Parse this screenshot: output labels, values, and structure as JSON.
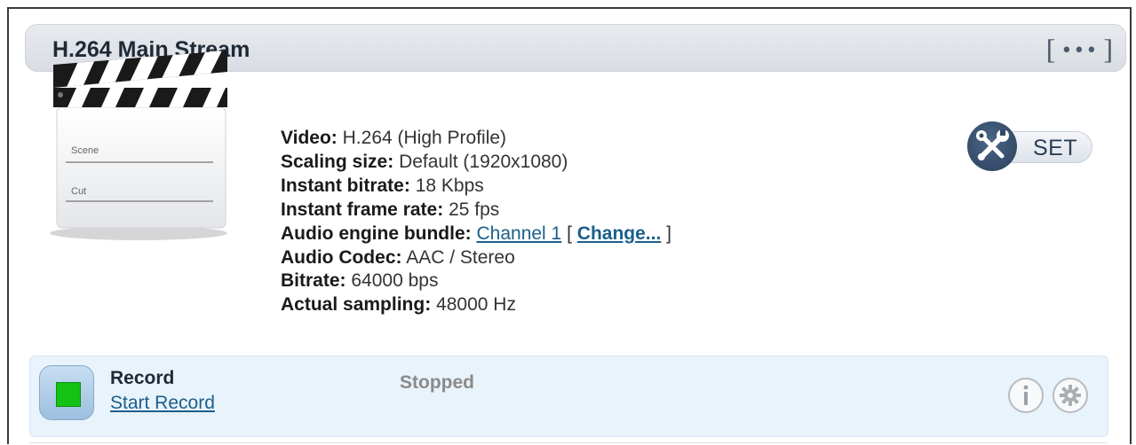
{
  "panel": {
    "title": "H.264 Main Stream",
    "menu_label": "•••"
  },
  "clapperboard": {
    "scene_label": "Scene",
    "cut_label": "Cut"
  },
  "stream_info": [
    {
      "key": "Video:",
      "value": "H.264 (High Profile)"
    },
    {
      "key": "Scaling size:",
      "value": "Default (1920x1080)"
    },
    {
      "key": "Instant bitrate:",
      "value": "18 Kbps"
    },
    {
      "key": "Instant frame rate:",
      "value": "25 fps"
    },
    {
      "key": "Audio engine bundle:",
      "link": "Channel 1",
      "change_link": "Change..."
    },
    {
      "key": "Audio Codec:",
      "value": "AAC / Stereo"
    },
    {
      "key": "Bitrate:",
      "value": "64000 bps"
    },
    {
      "key": "Actual sampling:",
      "value": "48000 Hz"
    }
  ],
  "set_button": {
    "label": "SET",
    "icon": "tools-icon"
  },
  "record": {
    "title": "Record",
    "action_link": "Start Record",
    "status": "Stopped",
    "info_icon": "info-icon",
    "settings_icon": "gear-icon",
    "indicator_color": "#13c213"
  },
  "colors": {
    "accent": "#1a5f8a",
    "header_bg": "#dde1e6",
    "record_bg": "#e9f3fb"
  }
}
